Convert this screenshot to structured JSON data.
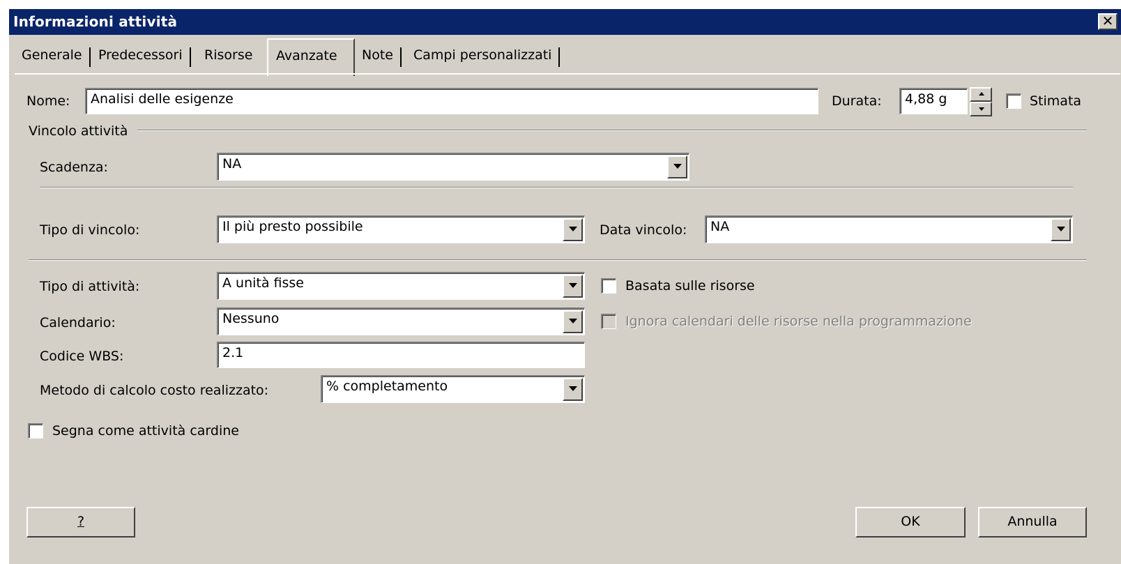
{
  "window": {
    "title": "Informazioni attività",
    "close_glyph": "✕"
  },
  "tabs": [
    {
      "label": "Generale"
    },
    {
      "label": "Predecessori"
    },
    {
      "label": "Risorse"
    },
    {
      "label": "Avanzate",
      "active": true
    },
    {
      "label": "Note"
    },
    {
      "label": "Campi personalizzati"
    }
  ],
  "name": {
    "label": "Nome:",
    "value": "Analisi delle esigenze"
  },
  "duration": {
    "label": "Durata:",
    "value": "4,88 g",
    "estimated_label": "Stimata",
    "estimated_checked": false
  },
  "constraint_group": {
    "title": "Vincolo attività"
  },
  "deadline": {
    "label": "Scadenza:",
    "value": "NA"
  },
  "constraint_type": {
    "label": "Tipo di vincolo:",
    "value": "Il più presto possibile"
  },
  "constraint_date": {
    "label": "Data vincolo:",
    "value": "NA"
  },
  "task_type": {
    "label": "Tipo di attività:",
    "value": "A unità fisse"
  },
  "effort_driven": {
    "label": "Basata sulle risorse",
    "checked": false
  },
  "calendar": {
    "label": "Calendario:",
    "value": "Nessuno"
  },
  "ignore_calendars": {
    "label": "Ignora calendari delle risorse nella programmazione",
    "checked": false,
    "enabled": false
  },
  "wbs": {
    "label": "Codice WBS:",
    "value": "2.1"
  },
  "earned_value": {
    "label": "Metodo di calcolo costo realizzato:",
    "value": "% completamento"
  },
  "milestone": {
    "label": "Segna come attività cardine",
    "checked": false
  },
  "buttons": {
    "help": "?",
    "ok": "OK",
    "cancel": "Annulla"
  },
  "colors": {
    "titlebar": "#0a246a",
    "face": "#d4d0c8",
    "disabled_text": "#808080"
  }
}
